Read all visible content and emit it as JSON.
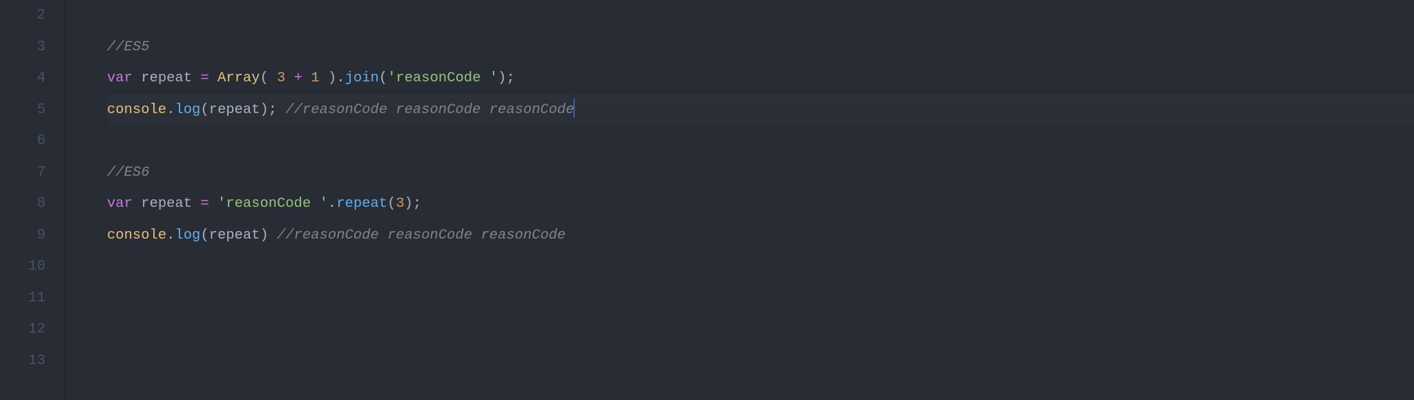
{
  "editor": {
    "gutter": {
      "start": 2,
      "end": 13,
      "numbers": [
        "2",
        "3",
        "4",
        "5",
        "6",
        "7",
        "8",
        "9",
        "10",
        "11",
        "12",
        "13"
      ]
    },
    "active_line_index": 3,
    "lines": [
      {
        "tokens": []
      },
      {
        "tokens": [
          {
            "cls": "tok-comment",
            "t": "//ES5"
          }
        ]
      },
      {
        "tokens": [
          {
            "cls": "tok-keyword",
            "t": "var"
          },
          {
            "cls": "tok-punct",
            "t": " "
          },
          {
            "cls": "tok-ident",
            "t": "repeat"
          },
          {
            "cls": "tok-punct",
            "t": " "
          },
          {
            "cls": "tok-keyword",
            "t": "="
          },
          {
            "cls": "tok-punct",
            "t": " "
          },
          {
            "cls": "tok-var",
            "t": "Array"
          },
          {
            "cls": "tok-punct",
            "t": "( "
          },
          {
            "cls": "tok-number",
            "t": "3"
          },
          {
            "cls": "tok-punct",
            "t": " "
          },
          {
            "cls": "tok-keyword",
            "t": "+"
          },
          {
            "cls": "tok-punct",
            "t": " "
          },
          {
            "cls": "tok-number",
            "t": "1"
          },
          {
            "cls": "tok-punct",
            "t": " )."
          },
          {
            "cls": "tok-func",
            "t": "join"
          },
          {
            "cls": "tok-punct",
            "t": "("
          },
          {
            "cls": "tok-string",
            "t": "'reasonCode '"
          },
          {
            "cls": "tok-punct",
            "t": ");"
          }
        ]
      },
      {
        "tokens": [
          {
            "cls": "tok-obj",
            "t": "console"
          },
          {
            "cls": "tok-punct",
            "t": "."
          },
          {
            "cls": "tok-func",
            "t": "log"
          },
          {
            "cls": "tok-punct",
            "t": "("
          },
          {
            "cls": "tok-ident",
            "t": "repeat"
          },
          {
            "cls": "tok-punct",
            "t": "); "
          },
          {
            "cls": "tok-comment",
            "t": "//reasonCode reasonCode reasonCode"
          }
        ],
        "cursor_after": true
      },
      {
        "tokens": []
      },
      {
        "tokens": [
          {
            "cls": "tok-comment",
            "t": "//ES6"
          }
        ]
      },
      {
        "tokens": [
          {
            "cls": "tok-keyword",
            "t": "var"
          },
          {
            "cls": "tok-punct",
            "t": " "
          },
          {
            "cls": "tok-ident",
            "t": "repeat"
          },
          {
            "cls": "tok-punct",
            "t": " "
          },
          {
            "cls": "tok-keyword",
            "t": "="
          },
          {
            "cls": "tok-punct",
            "t": " "
          },
          {
            "cls": "tok-string",
            "t": "'reasonCode '"
          },
          {
            "cls": "tok-punct",
            "t": "."
          },
          {
            "cls": "tok-func",
            "t": "repeat"
          },
          {
            "cls": "tok-punct",
            "t": "("
          },
          {
            "cls": "tok-number",
            "t": "3"
          },
          {
            "cls": "tok-punct",
            "t": ");"
          }
        ]
      },
      {
        "tokens": [
          {
            "cls": "tok-obj",
            "t": "console"
          },
          {
            "cls": "tok-punct",
            "t": "."
          },
          {
            "cls": "tok-func",
            "t": "log"
          },
          {
            "cls": "tok-punct",
            "t": "("
          },
          {
            "cls": "tok-ident",
            "t": "repeat"
          },
          {
            "cls": "tok-punct",
            "t": ") "
          },
          {
            "cls": "tok-comment",
            "t": "//reasonCode reasonCode reasonCode"
          }
        ]
      },
      {
        "tokens": []
      },
      {
        "tokens": []
      },
      {
        "tokens": []
      },
      {
        "tokens": []
      }
    ]
  }
}
